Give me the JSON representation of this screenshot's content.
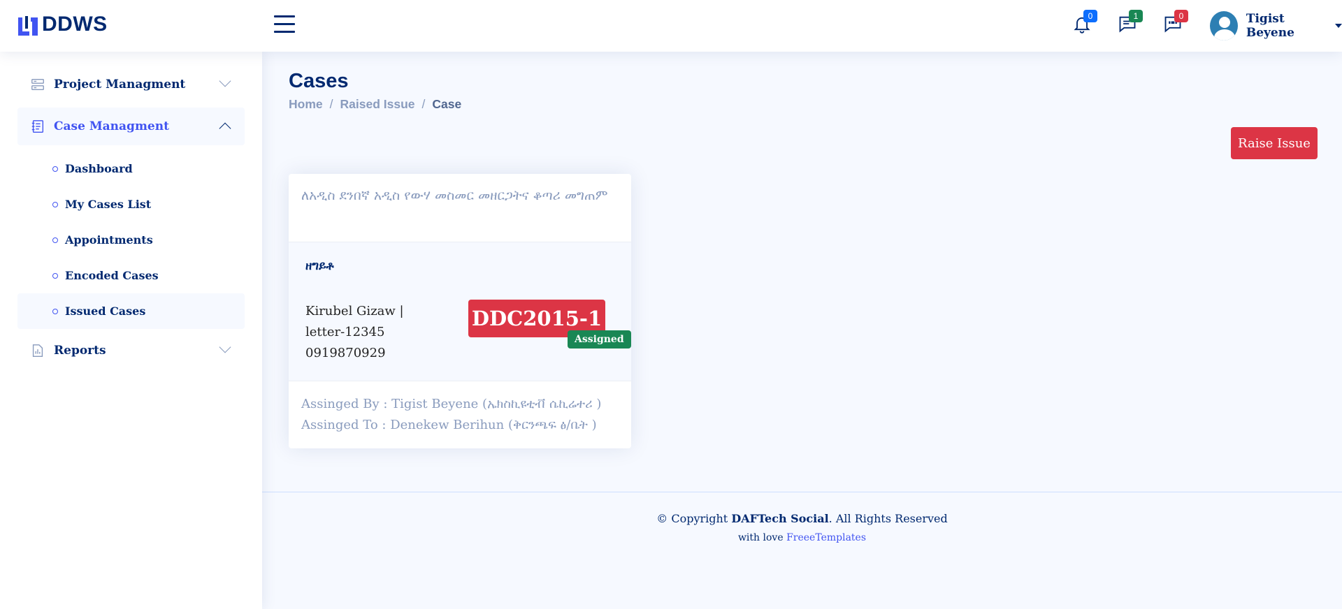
{
  "header": {
    "logo_text": "DDWS",
    "notifications_count": "0",
    "messages_count": "1",
    "chats_count": "0",
    "user_name": "Tigist Beyene"
  },
  "sidebar": {
    "project": "Project Managment",
    "case": "Case Managment",
    "sub_items": [
      "Dashboard",
      "My Cases List",
      "Appointments",
      "Encoded Cases",
      "Issued Cases"
    ],
    "reports": "Reports"
  },
  "page": {
    "title": "Cases",
    "breadcrumb": [
      "Home",
      "Raised Issue",
      "Case"
    ],
    "raise_button": "Raise Issue"
  },
  "card": {
    "title": "ለአዲስ ደንበኛ አዲስ የውሃ መስመር መዘርጋትና ቆጣሪ መግጠም",
    "category": "ዘግይቶ",
    "info_name": "Kirubel Gizaw |",
    "info_letter": "letter-12345",
    "info_phone": "0919870929",
    "case_code": "DDC2015-1",
    "status": "Assigned",
    "assigned_by": "Assinged By : Tigist Beyene (ኤክስኪዩቲቭ ሴኪሬተሪ )",
    "assigned_to": "Assinged To : Denekew Berihun (ቅርንጫፍ ፅ/ቤት )"
  },
  "footer": {
    "copy_prefix": "© Copyright ",
    "brand": "DAFTech Social",
    "copy_suffix": ". All Rights Reserved",
    "credits_prefix": "with love ",
    "credits_link": "FreeeTemplates"
  },
  "colors": {
    "accent": "#4154f1",
    "navy": "#012970",
    "danger": "#dc3545",
    "success": "#198754"
  }
}
